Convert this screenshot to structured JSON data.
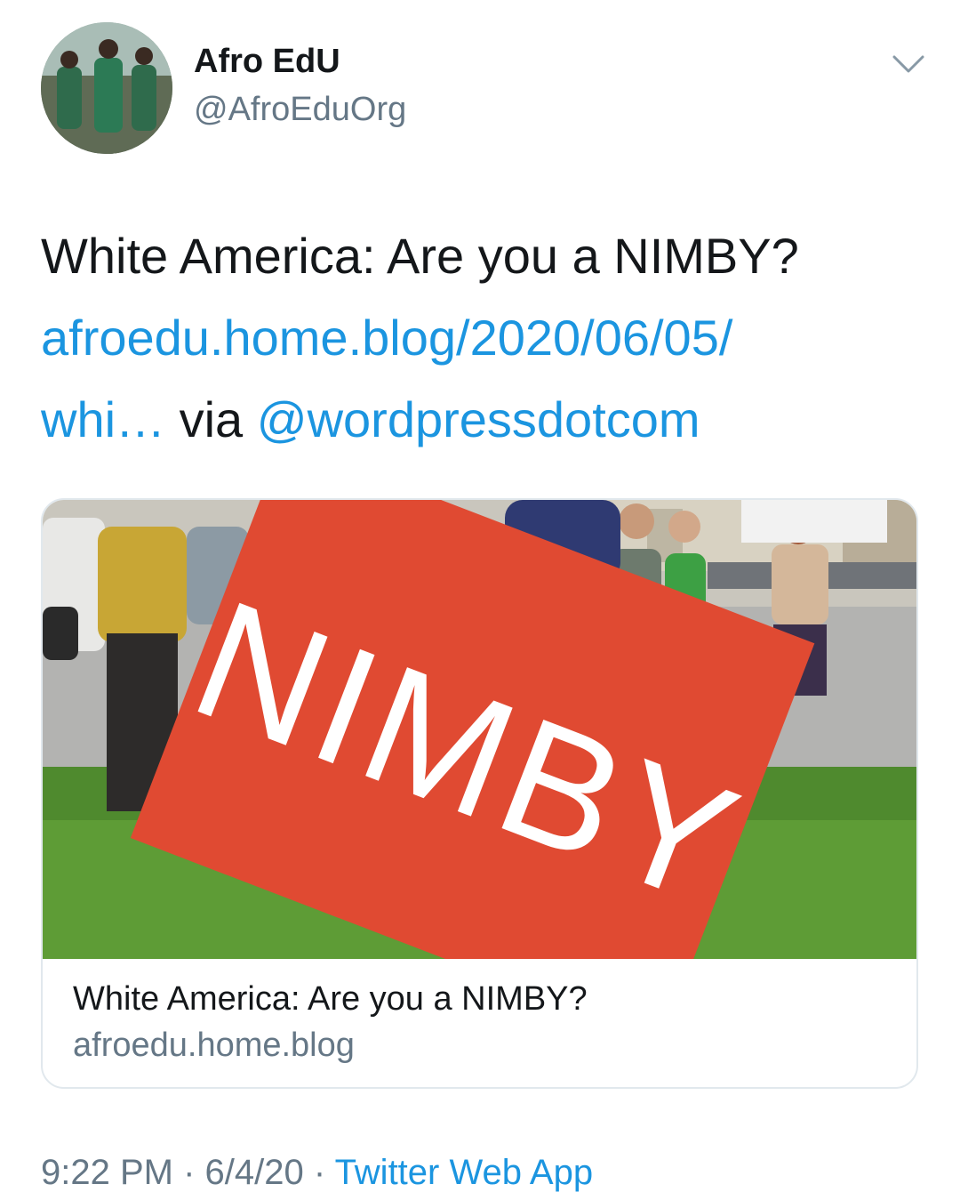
{
  "author": {
    "display_name": "Afro EdU",
    "handle": "@AfroEduOrg",
    "avatar_icon": "avatar-photo"
  },
  "tweet": {
    "text": "White America: Are you a NIMBY?",
    "link_part1": "afroedu.home.blog/2020/06/05/",
    "link_part2": "whi…",
    "via_word": " via ",
    "mention": "@wordpressdotcom"
  },
  "card": {
    "image_sign_text": "NIMBY",
    "title": "White America: Are you a NIMBY?",
    "domain": "afroedu.home.blog"
  },
  "meta": {
    "time": "9:22 PM",
    "sep1": " · ",
    "date": "6/4/20",
    "sep2": " · ",
    "app": "Twitter Web App"
  },
  "colors": {
    "link": "#1b95e0",
    "secondary_text": "#657786",
    "sign_red": "#e04a32"
  }
}
